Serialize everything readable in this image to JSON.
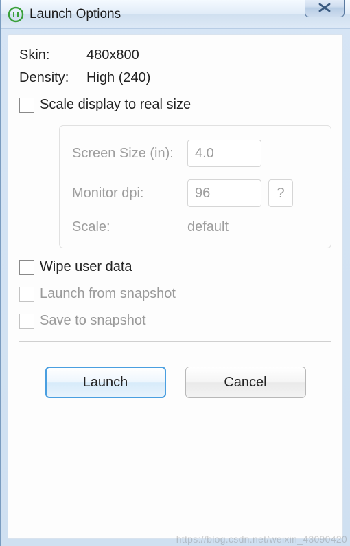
{
  "window": {
    "title": "Launch Options"
  },
  "info": {
    "skin_label": "Skin:",
    "skin_value": "480x800",
    "density_label": "Density:",
    "density_value": "High (240)"
  },
  "options": {
    "scale_label": "Scale display to real size",
    "wipe_label": "Wipe user data",
    "launch_snapshot_label": "Launch from snapshot",
    "save_snapshot_label": "Save to snapshot"
  },
  "scale_group": {
    "screen_size_label": "Screen Size (in):",
    "screen_size_value": "4.0",
    "monitor_dpi_label": "Monitor dpi:",
    "monitor_dpi_value": "96",
    "help_label": "?",
    "scale_label": "Scale:",
    "scale_value": "default"
  },
  "buttons": {
    "launch": "Launch",
    "cancel": "Cancel"
  },
  "watermark": "https://blog.csdn.net/weixin_43090420"
}
